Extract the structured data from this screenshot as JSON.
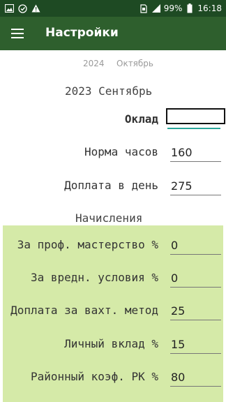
{
  "status_bar": {
    "left_icons": [
      "image-icon",
      "sync-icon",
      "warning-icon"
    ],
    "battery": "99%",
    "time": "16:18"
  },
  "app_bar": {
    "title": "Настройки"
  },
  "year_tabs": {
    "year": "2024",
    "month": "Октябрь"
  },
  "period": "2023 Сентябрь",
  "general": [
    {
      "label": "Оклад",
      "value": "",
      "bold": true
    },
    {
      "label": "Норма часов",
      "value": "160"
    },
    {
      "label": "Доплата в день",
      "value": "275"
    }
  ],
  "accruals": {
    "title": "Начисления",
    "rows": [
      {
        "label": "За проф. мастерство %",
        "value": "0"
      },
      {
        "label": "За вредн. условия %",
        "value": "0"
      },
      {
        "label": "Доплата за вахт. метод",
        "value": "25"
      },
      {
        "label": "Личный вклад %",
        "value": "15"
      },
      {
        "label": "Районный коэф. РК %",
        "value": "80"
      }
    ]
  },
  "colors": {
    "status_bar": "#1e4a23",
    "app_bar": "#2e5f2d",
    "accruals_bg": "#d5eaa8",
    "focus_accent": "#2aa69a"
  }
}
